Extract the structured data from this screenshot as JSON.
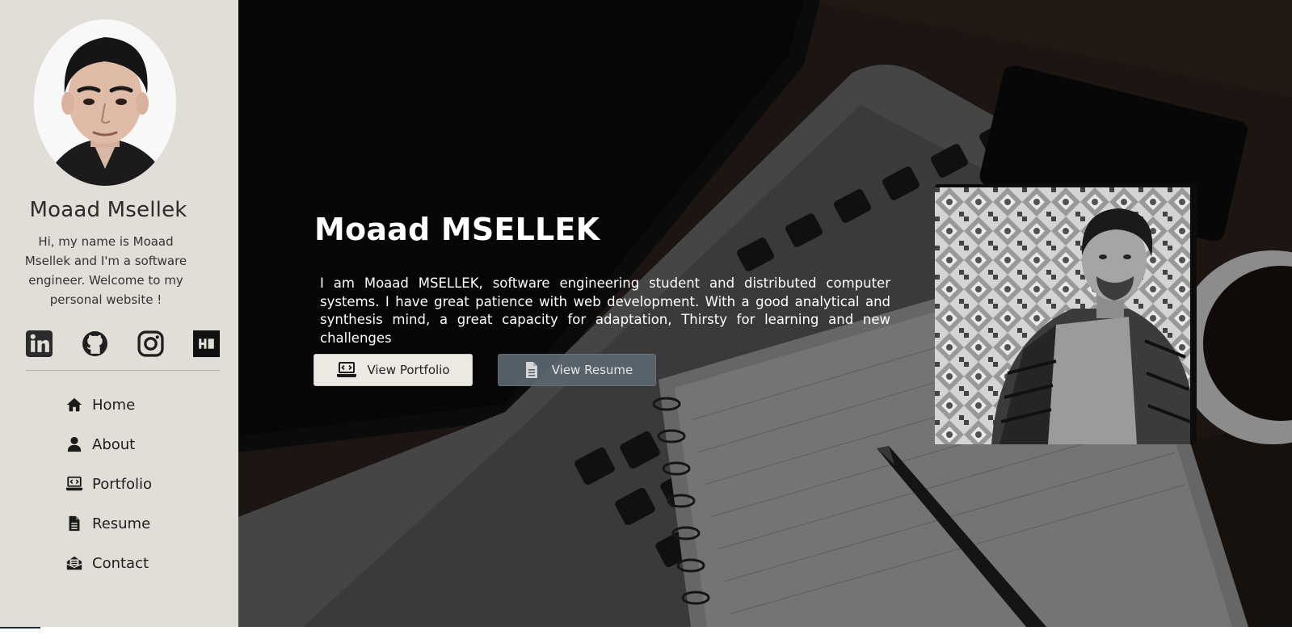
{
  "sidebar": {
    "name": "Moaad Msellek",
    "intro": "Hi, my name is Moaad Msellek and I'm a software engineer. Welcome to my personal website !",
    "socials": [
      {
        "icon": "linkedin-icon"
      },
      {
        "icon": "github-icon"
      },
      {
        "icon": "instagram-icon"
      },
      {
        "icon": "hackerrank-icon"
      }
    ],
    "nav": [
      {
        "label": "Home",
        "icon": "home-icon"
      },
      {
        "label": "About",
        "icon": "user-icon"
      },
      {
        "label": "Portfolio",
        "icon": "laptop-code-icon"
      },
      {
        "label": "Resume",
        "icon": "file-icon"
      },
      {
        "label": "Contact",
        "icon": "envelope-open-icon"
      }
    ]
  },
  "hero": {
    "title": "Moaad MSELLEK",
    "text": "I am Moaad MSELLEK, software engineering student and distributed computer systems. I have great patience with web development. With a good analytical and synthesis mind, a great capacity for adaptation, Thirsty for learning and new challenges",
    "buttons": {
      "portfolio": "View Portfolio",
      "resume": "View Resume"
    }
  },
  "colors": {
    "sidebar_bg": "#e1ddd7",
    "text_dark": "#1e1e1e",
    "btn_light": "#ece8e2",
    "btn_slate": "#5b6670"
  }
}
